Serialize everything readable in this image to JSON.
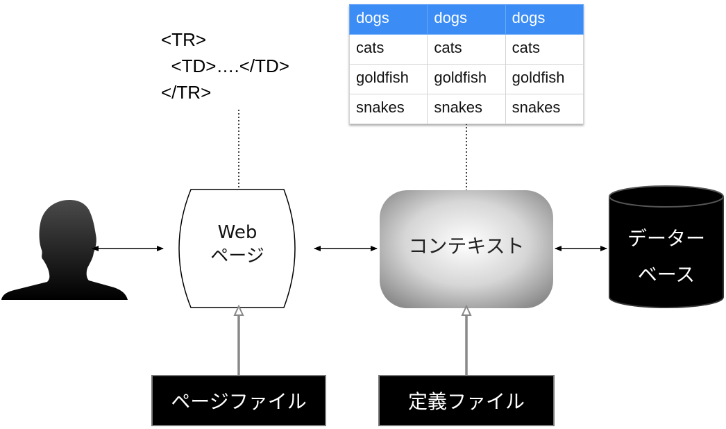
{
  "code_snippet": {
    "line1": "<TR>",
    "line2": "  <TD>….</TD>",
    "line3": "</TR>"
  },
  "table": {
    "header": [
      "dogs",
      "dogs",
      "dogs"
    ],
    "rows": [
      [
        "cats",
        "cats",
        "cats"
      ],
      [
        "goldfish",
        "goldfish",
        "goldfish"
      ],
      [
        "snakes",
        "snakes",
        "snakes"
      ]
    ],
    "header_color": "#3b8df5"
  },
  "nodes": {
    "user": {
      "icon": "user-silhouette-icon"
    },
    "web_page": {
      "line1": "Web",
      "line2": "ページ"
    },
    "context": {
      "label": "コンテキスト"
    },
    "database": {
      "line1": "データー",
      "line2": "ベース",
      "icon": "database-cylinder-icon"
    },
    "page_file": {
      "label": "ページファイル"
    },
    "definition_file": {
      "label": "定義ファイル"
    }
  }
}
